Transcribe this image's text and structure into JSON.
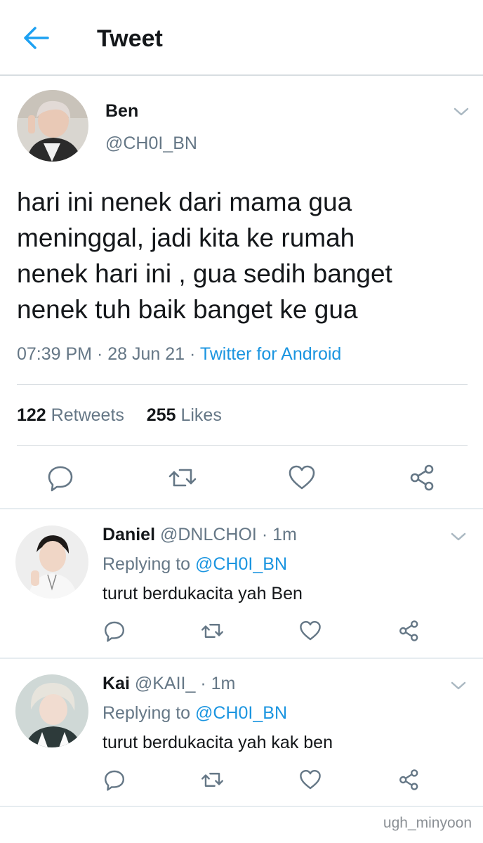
{
  "header": {
    "title": "Tweet",
    "back_icon": "arrow-left-icon",
    "accent": "#1da1f2"
  },
  "tweet": {
    "name": "Ben",
    "handle": "@CH0I_BN",
    "text_lines": [
      "hari ini nenek dari mama gua",
      "meninggal, jadi kita ke rumah",
      "nenek hari ini , gua sedih banget",
      "nenek tuh baik banget ke gua"
    ],
    "time": "07:39 PM",
    "date": "28 Jun 21",
    "source": "Twitter for Android",
    "retweets": "122",
    "retweets_label": "Retweets",
    "likes": "255",
    "likes_label": "Likes"
  },
  "actions": [
    "reply-icon",
    "retweet-icon",
    "like-icon",
    "share-icon"
  ],
  "replies": [
    {
      "name": "Daniel",
      "handle": "@DNLCHOI",
      "time": "1m",
      "replying_to_label": "Replying to",
      "replying_to": "@CH0I_BN",
      "text": "turut berdukacita yah Ben"
    },
    {
      "name": "Kai",
      "handle": "@KAII_",
      "time": "1m",
      "replying_to_label": "Replying to",
      "replying_to": "@CH0I_BN",
      "text": "turut berdukacita yah kak ben"
    }
  ],
  "watermark": "ugh_minyoon",
  "colors": {
    "link": "#1b95e0",
    "secondary_text": "#657786",
    "icon": "#657786"
  }
}
